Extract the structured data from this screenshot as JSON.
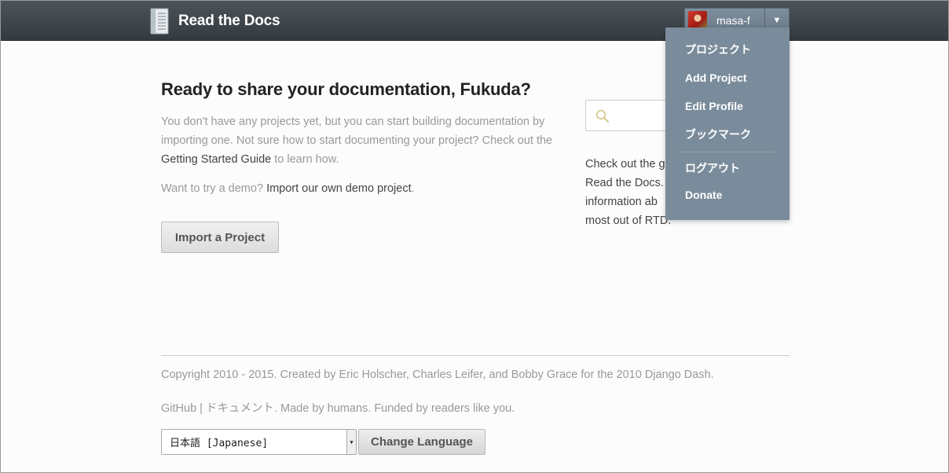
{
  "header": {
    "logo_text": "Read the Docs",
    "username": "masa-f",
    "caret": "▼"
  },
  "dropdown": {
    "items": [
      "プロジェクト",
      "Add Project",
      "Edit Profile",
      "ブックマーク",
      "ログアウト",
      "Donate"
    ]
  },
  "main": {
    "heading": "Ready to share your documentation, Fukuda?",
    "intro_before": "You don't have any projects yet, but you can start building documentation by importing one. Not sure how to start documenting your project? Check out the ",
    "intro_link": "Getting Started Guide",
    "intro_after": " to learn how.",
    "demo_before": "Want to try a demo? ",
    "demo_link": "Import our own demo project",
    "demo_after": ".",
    "import_button": "Import a Project"
  },
  "sidebar": {
    "search_placeholder": "",
    "line1_before": "Check out the ",
    "line1_link": "g",
    "line2_link": "Read the Docs",
    "line2_after": ".",
    "line3": "information ab",
    "line4": "most out of RTD."
  },
  "footer": {
    "copyright_prefix": "Copyright 2010 - 2015. Created by ",
    "author1": "Eric Holscher",
    "sep1": ", ",
    "author2": "Charles Leifer",
    "sep2": ", and ",
    "author3": "Bobby Grace",
    "copyright_mid": " for the 2010 ",
    "django_dash": "Django Dash",
    "copyright_end": ".",
    "github": "GitHub",
    "pipe": " | ",
    "docs": "ドキュメント",
    "made_by": ". Made by ",
    "humans": "humans",
    "funded_by": ". Funded by ",
    "readers": "readers like you",
    "end": ".",
    "language_selected": "日本語 [Japanese]",
    "change_language": "Change Language"
  },
  "colors": {
    "header": "#3f464b",
    "dropdown": "#7a8c9b",
    "muted_text": "#999999"
  }
}
